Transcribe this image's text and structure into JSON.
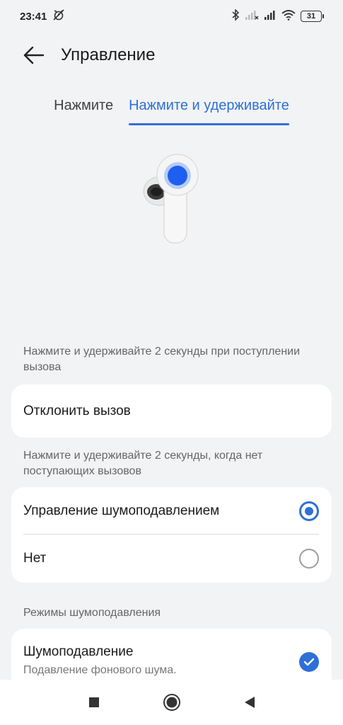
{
  "status_bar": {
    "time": "23:41",
    "battery": "31"
  },
  "header": {
    "title": "Управление"
  },
  "tabs": [
    {
      "label": "Нажмите",
      "active": false
    },
    {
      "label": "Нажмите и удерживайте",
      "active": true
    }
  ],
  "incoming_call": {
    "description": "Нажмите и удерживайте 2 секунды при поступлении вызова",
    "action_label": "Отклонить вызов"
  },
  "no_call": {
    "description": "Нажмите и удерживайте 2 секунды, когда нет поступающих вызовов",
    "options": [
      {
        "label": "Управление шумоподавлением",
        "selected": true
      },
      {
        "label": "Нет",
        "selected": false
      }
    ]
  },
  "noise_modes": {
    "title": "Режимы шумоподавления",
    "items": [
      {
        "label": "Шумоподавление",
        "sublabel": "Подавление фонового шума.",
        "checked": true
      }
    ]
  },
  "colors": {
    "accent": "#2f6fd6",
    "background": "#f1f3f5",
    "card": "#ffffff"
  }
}
